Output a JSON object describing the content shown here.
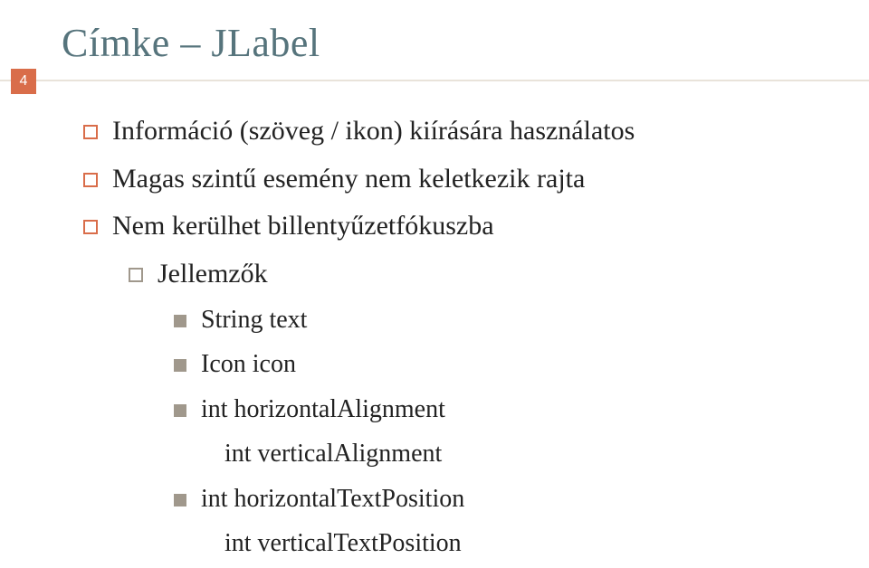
{
  "page_number": "4",
  "title": "Címke – JLabel",
  "bullets": {
    "b1": "Információ (szöveg / ikon) kiírására használatos",
    "b2": "Magas szintű esemény nem keletkezik rajta",
    "b3": "Nem kerülhet billentyűzetfókuszba",
    "b4": "Jellemzők",
    "b4_1": "String text",
    "b4_2": "Icon icon",
    "b4_3": "int horizontalAlignment",
    "b4_3_a": "int verticalAlignment",
    "b4_4": "int horizontalTextPosition",
    "b4_4_a": "int verticalTextPosition"
  }
}
